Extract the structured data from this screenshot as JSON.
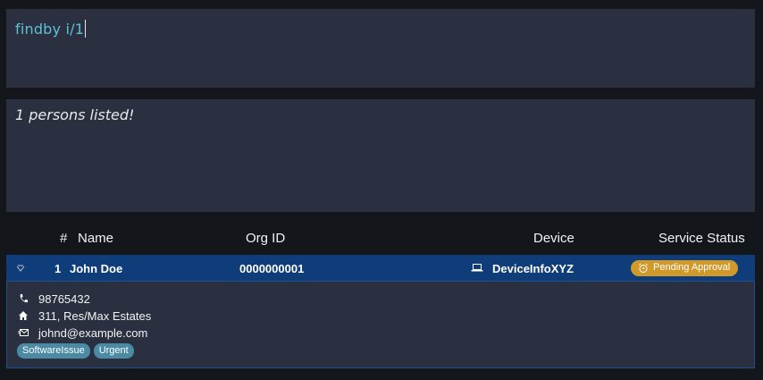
{
  "command": {
    "input_value": "findby i/1"
  },
  "result": {
    "message": "1 persons listed!"
  },
  "table": {
    "headers": {
      "index": "#",
      "name": "Name",
      "org_id": "Org ID",
      "device": "Device",
      "service_status": "Service Status"
    },
    "rows": [
      {
        "index": "1",
        "name": "John Doe",
        "org_id": "0000000001",
        "device": "DeviceInfoXYZ",
        "device_icon": "laptop-icon",
        "status": "Pending Approval",
        "status_icon": "alarm-clock-icon",
        "details": {
          "phone": "98765432",
          "address": "311, Res/Max Estates",
          "email": "johnd@example.com",
          "tags": [
            "SoftwareIssue",
            "Urgent"
          ]
        }
      }
    ]
  },
  "colors": {
    "background": "#13161b",
    "panel": "#2b3040",
    "selected_row": "#0f3d7a",
    "command_text": "#5ec0d6",
    "status_pending": "#d09a2a",
    "tag": "#4a8aa3"
  }
}
